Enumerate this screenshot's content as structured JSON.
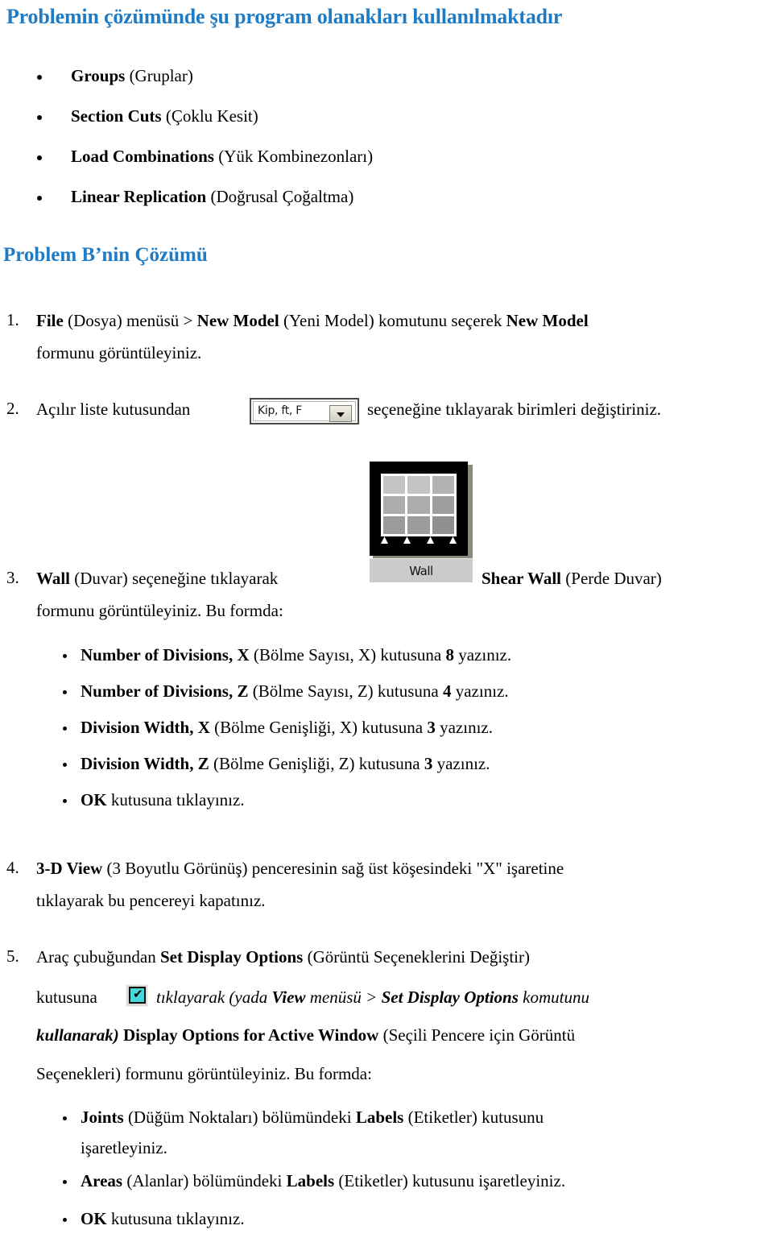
{
  "document": {
    "heading_main": "Problemin çözümünde şu program olanakları kullanılmaktadır",
    "heading_sub": "Problem B’nin Çözümü"
  },
  "feature_list": [
    {
      "bold": "Groups",
      "rest": " (Gruplar)"
    },
    {
      "bold": "Section Cuts",
      "rest": " (Çoklu Kesit)"
    },
    {
      "bold": "Load Combinations",
      "rest": " (Yük Kombinezonları)"
    },
    {
      "bold": "Linear Replication",
      "rest": " (Doğrusal Çoğaltma)"
    }
  ],
  "steps": {
    "n1": "1.",
    "n2": "2.",
    "n3": "3.",
    "n4": "4.",
    "n5": "5.",
    "step1": {
      "part_a_bold": "File",
      "part_b": " (Dosya) menüsü > ",
      "part_c_bold": "New Model",
      "part_d": " (Yeni Model) komutunu seçerek ",
      "part_e_bold": "New Model",
      "line2": "formunu görüntüleyiniz."
    },
    "step2": {
      "before": "Açılır liste kutusundan",
      "after": "seçeneğine tıklayarak birimleri değiştiriniz."
    },
    "step3": {
      "a_bold": "Wall",
      "b": " (Duvar) seçeneğine tıklayarak",
      "c_bold": "Shear Wall",
      "d": " (Perde Duvar)",
      "line2": "formunu görüntüleyiniz. Bu formda:"
    },
    "step3_bullets": [
      {
        "bold": "Number of Divisions, X",
        "mid": " (Bölme Sayısı, X) kutusuna ",
        "value": "8",
        "tail": " yazınız."
      },
      {
        "bold": "Number of Divisions, Z",
        "mid": " (Bölme Sayısı, Z) kutusuna ",
        "value": "4",
        "tail": " yazınız."
      },
      {
        "bold": "Division Width, X",
        "mid": " (Bölme Genişliği, X) kutusuna ",
        "value": "3",
        "tail": " yazınız."
      },
      {
        "bold": "Division Width, Z",
        "mid": " (Bölme Genişliği, Z) kutusuna ",
        "value": "3",
        "tail": " yazınız."
      },
      {
        "bold": "OK",
        "mid": " kutusuna tıklayınız.",
        "value": "",
        "tail": ""
      }
    ],
    "step4": {
      "a_bold": "3-D View",
      "b": " (3 Boyutlu Görünüş) penceresinin sağ üst köşesindeki \"X\" işaretine",
      "line2": "tıklayarak bu pencereyi kapatınız."
    },
    "step5": {
      "a": "Araç çubuğundan ",
      "b_bold": "Set Display Options",
      "c": " (Görüntü Seçeneklerini Değiştir)",
      "line2_a": "kutusuna",
      "line2_b_italic": "tıklayarak (yada ",
      "line2_c_bolditalic": "View",
      "line2_d_italic": " menüsü > ",
      "line2_e_bolditalic": "Set Display Options",
      "line2_f_italic": " komutunu",
      "line3_a_bolditalic": "kullanarak)",
      "line3_b_bold": " Display Options for Active Window",
      "line3_c": " (Seçili Pencere için Görüntü",
      "line4": "Seçenekleri) formunu görüntüleyiniz. Bu formda:"
    },
    "step5_bullets": [
      {
        "bold": "Joints",
        "mid": " (Düğüm Noktaları) bölümündeki ",
        "bold2": "Labels",
        "tail": " (Etiketler) kutusunu",
        "line2": "işaretleyiniz."
      },
      {
        "bold": "Areas",
        "mid": " (Alanlar) bölümündeki ",
        "bold2": "Labels",
        "tail": " (Etiketler) kutusunu işaretleyiniz.",
        "line2": ""
      },
      {
        "bold": "OK",
        "mid": " kutusuna tıklayınız.",
        "bold2": "",
        "tail": "",
        "line2": ""
      }
    ]
  },
  "widgets": {
    "units_combo": {
      "value": "Kip, ft, F",
      "icon": "chevron-down-icon"
    },
    "wall_toolbar": {
      "label": "Wall",
      "icon": "wall-grid-icon"
    },
    "display_options_toolbar": {
      "icon": "checkbox-checked-icon",
      "glyph": "✔"
    }
  },
  "colors": {
    "heading": "#1F7BC4",
    "text": "#000000",
    "page_bg": "#FFFFFF"
  }
}
